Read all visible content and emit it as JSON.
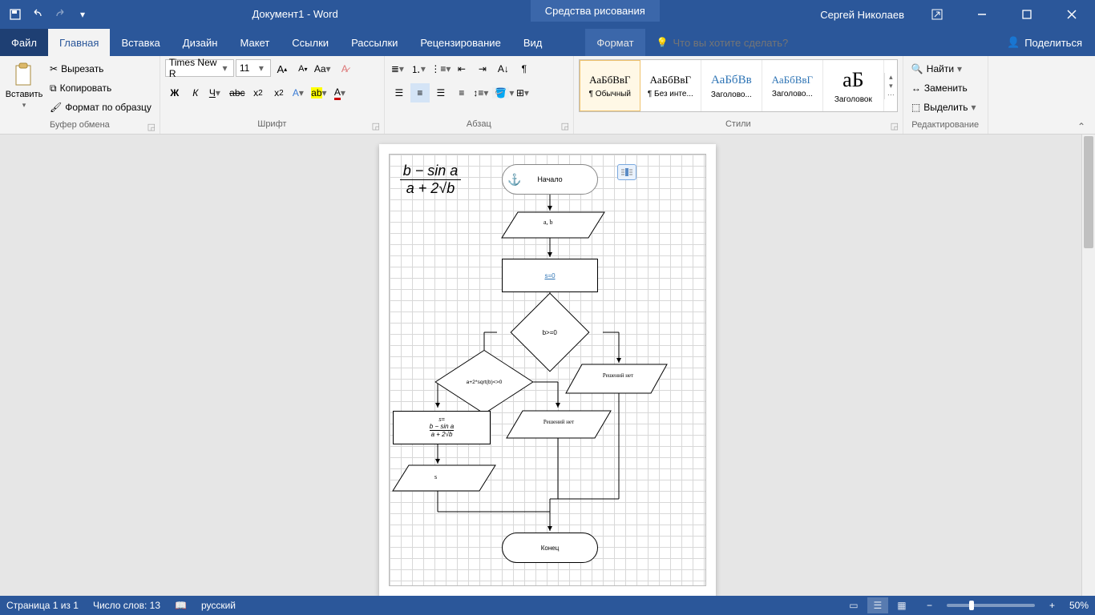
{
  "titlebar": {
    "doc_title": "Документ1 - Word",
    "context_tool": "Средства рисования",
    "user": "Сергей Николаев"
  },
  "tabs": {
    "file": "Файл",
    "items": [
      "Главная",
      "Вставка",
      "Дизайн",
      "Макет",
      "Ссылки",
      "Рассылки",
      "Рецензирование",
      "Вид"
    ],
    "format": "Формат",
    "tellme_placeholder": "Что вы хотите сделать?",
    "share": "Поделиться"
  },
  "ribbon": {
    "paste": "Вставить",
    "cut": "Вырезать",
    "copy": "Копировать",
    "format_painter": "Формат по образцу",
    "group_clipboard": "Буфер обмена",
    "font_name": "Times New R",
    "font_size": "11",
    "group_font": "Шрифт",
    "group_paragraph": "Абзац",
    "styles": [
      {
        "preview": "АаБбВвГ",
        "name": "¶ Обычный"
      },
      {
        "preview": "АаБбВвГ",
        "name": "¶ Без инте..."
      },
      {
        "preview": "АаБбВв",
        "name": "Заголово..."
      },
      {
        "preview": "АаБбВвГ",
        "name": "Заголово..."
      },
      {
        "preview": "аБ",
        "name": "Заголовок"
      }
    ],
    "group_styles": "Стили",
    "find": "Найти",
    "replace": "Заменить",
    "select": "Выделить",
    "group_editing": "Редактирование"
  },
  "flowchart": {
    "start": "Начало",
    "input": "a, b",
    "assign": "s=0",
    "cond1": "b>=0",
    "cond2": "a+2*sqrt(b)<>0",
    "formula_num": "b − sin a",
    "formula_den": "a + 2√b",
    "no_solution1": "Решений нет",
    "no_solution2": "Решений нет",
    "output": "s",
    "end": "Конец"
  },
  "statusbar": {
    "page": "Страница 1 из 1",
    "words": "Число слов: 13",
    "lang": "русский",
    "zoom": "50%"
  }
}
